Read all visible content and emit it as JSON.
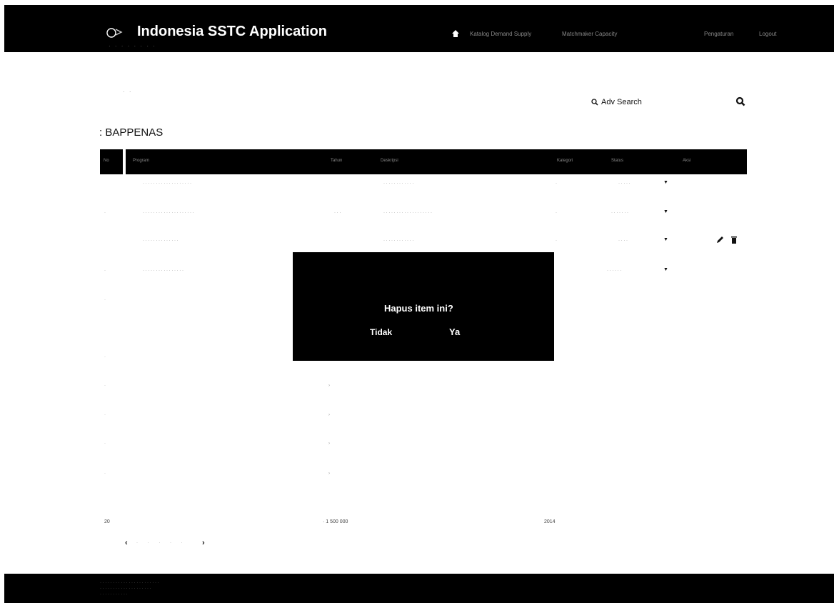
{
  "app": {
    "title": "Indonesia SSTC Application",
    "subtitle": "· · · · · · · ·"
  },
  "nav": {
    "links": [
      "Katalog Demand Supply",
      "Matchmaker Capacity",
      "Pengaturan",
      "Logout"
    ]
  },
  "toolbar": {
    "adv_search_label": "Adv Search",
    "dots": "· ·"
  },
  "page": {
    "org_title": "BAPPENAS"
  },
  "table": {
    "headers": [
      "No",
      "Program",
      "Tahun",
      "Deskripsi",
      "Kategori",
      "Status",
      "Aksi"
    ],
    "rows": [
      {
        "no": "",
        "name": "· · · · · · · · · · · · · · · · · · ·",
        "year": "",
        "desc": "· · · · · · · · · · · ·",
        "cat": "·",
        "status": "· · · · ·"
      },
      {
        "no": "·",
        "name": "· · · · · · · · · · · · · · · · · · · ·",
        "year": "· · ·",
        "desc": "· · · · · · · · · · · · · · · · · · ·",
        "cat": "·",
        "status": "· · · · · · ·"
      },
      {
        "no": "",
        "name": "· · · · · · · · · · · · · ·",
        "year": "",
        "desc": "· · · · · · · · · · · ·",
        "cat": "·",
        "status": "· · · ·"
      },
      {
        "no": "·",
        "name": "· · · · · · · · · · · · · · · ·",
        "year": "",
        "desc": "",
        "cat": "",
        "status": "· · · · · ·"
      }
    ],
    "last_row": {
      "no": "20",
      "budget": "· 1 500 000",
      "year": "2014"
    }
  },
  "modal": {
    "message": "Hapus item ini?",
    "cancel_label": "Tidak",
    "confirm_label": "Ya"
  },
  "pager": {
    "prev": "‹",
    "pages": "· · · · ·",
    "next": "›"
  },
  "footer": {
    "line1": "· · · · · · · · · · · · · · · · · · · · · · ·",
    "line2": "· · · · · · · · · · · · · · · · · · · ·",
    "line3": "· · · · · · · · · · ·"
  },
  "colors": {
    "bar": "#000000",
    "modal": "#000000",
    "text": "#111111"
  },
  "icons": [
    "logo-icon",
    "home-icon",
    "search-icon",
    "magnifier-icon",
    "edit-icon",
    "delete-icon",
    "chevron-left-icon",
    "chevron-right-icon"
  ]
}
